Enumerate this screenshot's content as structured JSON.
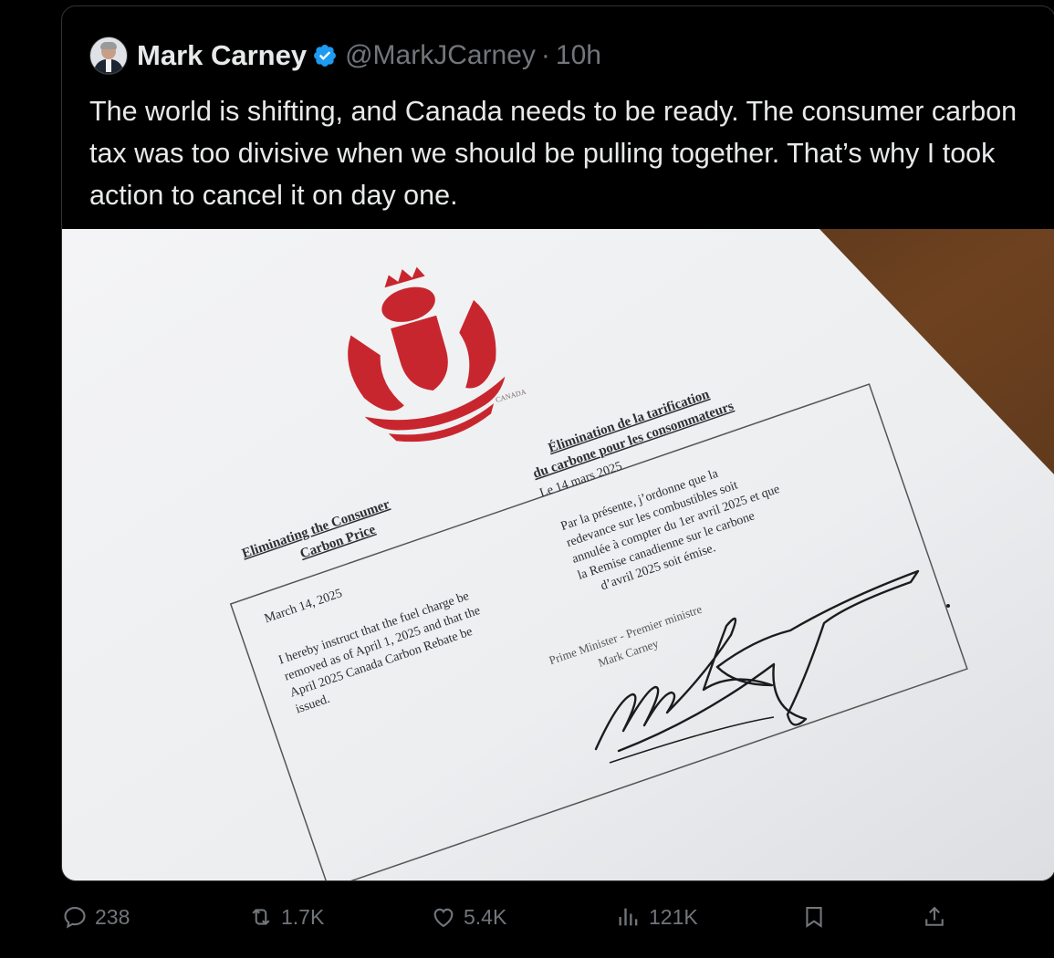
{
  "tweet": {
    "author_name": "Mark Carney",
    "handle": "@MarkJCarney",
    "separator": "·",
    "time": "10h",
    "text": "The world is shifting, and Canada needs to be ready. The consumer carbon tax was too divisive when we should be pulling together. That’s why I took action to cancel it on day one."
  },
  "document": {
    "coat_of_arms_caption": "CANADA",
    "en_title_1": "Eliminating the Consumer",
    "en_title_2": "Carbon Price",
    "fr_title_1": "Élimination de la tarification",
    "fr_title_2": "du carbone pour les consommateurs",
    "en_date": "March 14, 2025",
    "fr_date": "Le 14 mars 2025",
    "en_body": [
      "I hereby instruct that the fuel charge be",
      "removed as of April 1, 2025 and that the",
      "April 2025 Canada Carbon Rebate be",
      "issued."
    ],
    "fr_body": [
      "Par la présente, j’ordonne que la",
      "redevance sur les combustibles soit",
      "annulée à compter du 1er avril 2025 et que",
      "la Remise canadienne sur le carbone",
      "d’avril 2025 soit émise."
    ],
    "signatory_title": "Prime Minister - Premier ministre",
    "signatory_name": "Mark Carney"
  },
  "actions": {
    "reply_count": "238",
    "repost_count": "1.7K",
    "like_count": "5.4K",
    "view_count": "121K"
  },
  "colors": {
    "background": "#000000",
    "text": "#e7e9ea",
    "muted": "#71767b",
    "verified": "#1d9bf0",
    "crest_red": "#c8262e"
  }
}
